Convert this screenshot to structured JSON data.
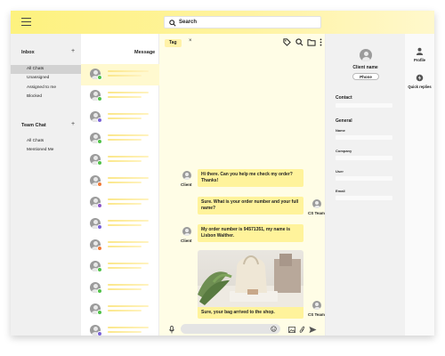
{
  "search": {
    "placeholder": "Search"
  },
  "sidebar": {
    "inbox": {
      "title": "Inbox",
      "items": [
        {
          "label": "All Chats",
          "active": true
        },
        {
          "label": "Unassigned",
          "active": false
        },
        {
          "label": "Assigned to me",
          "active": false
        },
        {
          "label": "Blocked",
          "active": false
        }
      ]
    },
    "team_chat": {
      "title": "Team Chat",
      "items": [
        {
          "label": "All Chats"
        },
        {
          "label": "Mentioned Me"
        }
      ]
    }
  },
  "conversations": {
    "title": "Message",
    "items": [
      {
        "channel_color": "#52c24a",
        "selected": true
      },
      {
        "channel_color": "#52c24a",
        "selected": false
      },
      {
        "channel_color": "#7a63d8",
        "selected": false
      },
      {
        "channel_color": "#52c24a",
        "selected": false
      },
      {
        "channel_color": "#52c24a",
        "selected": false
      },
      {
        "channel_color": "#f07b3a",
        "selected": false
      },
      {
        "channel_color": "#8e58c8",
        "selected": false
      },
      {
        "channel_color": "#7a63d8",
        "selected": false
      },
      {
        "channel_color": "#f07b3a",
        "selected": false
      },
      {
        "channel_color": "#52c24a",
        "selected": false
      },
      {
        "channel_color": "#52c24a",
        "selected": false
      },
      {
        "channel_color": "#52c24a",
        "selected": false
      },
      {
        "channel_color": "#7a63d8",
        "selected": false
      }
    ]
  },
  "chat": {
    "tag": "Tag",
    "tag_close": "×",
    "messages": [
      {
        "from": "Client",
        "text": "Hi there. Can you help me check my order? Thanks!"
      },
      {
        "from": "CS Team",
        "text": "Sure. What is your order number and your full name?"
      },
      {
        "from": "Client",
        "text": "My order number is 94571351, my name is Lisbon Walther."
      },
      {
        "from": "CS Team",
        "text": "Sure, your bag arrived to the shop."
      }
    ]
  },
  "contact": {
    "name": "Client name",
    "phone_label": "Phone",
    "contact_title": "Contact",
    "general_title": "General",
    "fields": [
      "Name",
      "Company",
      "User",
      "Email"
    ]
  },
  "rail": {
    "items": [
      {
        "label": "Profile",
        "icon": "profile-icon"
      },
      {
        "label": "Quick replies",
        "icon": "quick-replies-icon"
      }
    ]
  },
  "colors": {
    "accent": "#fff39b",
    "topbar": "#fdf27e",
    "selected_row": "#fff9cf",
    "chat_bg": "#fffde6",
    "send": "#555555"
  }
}
